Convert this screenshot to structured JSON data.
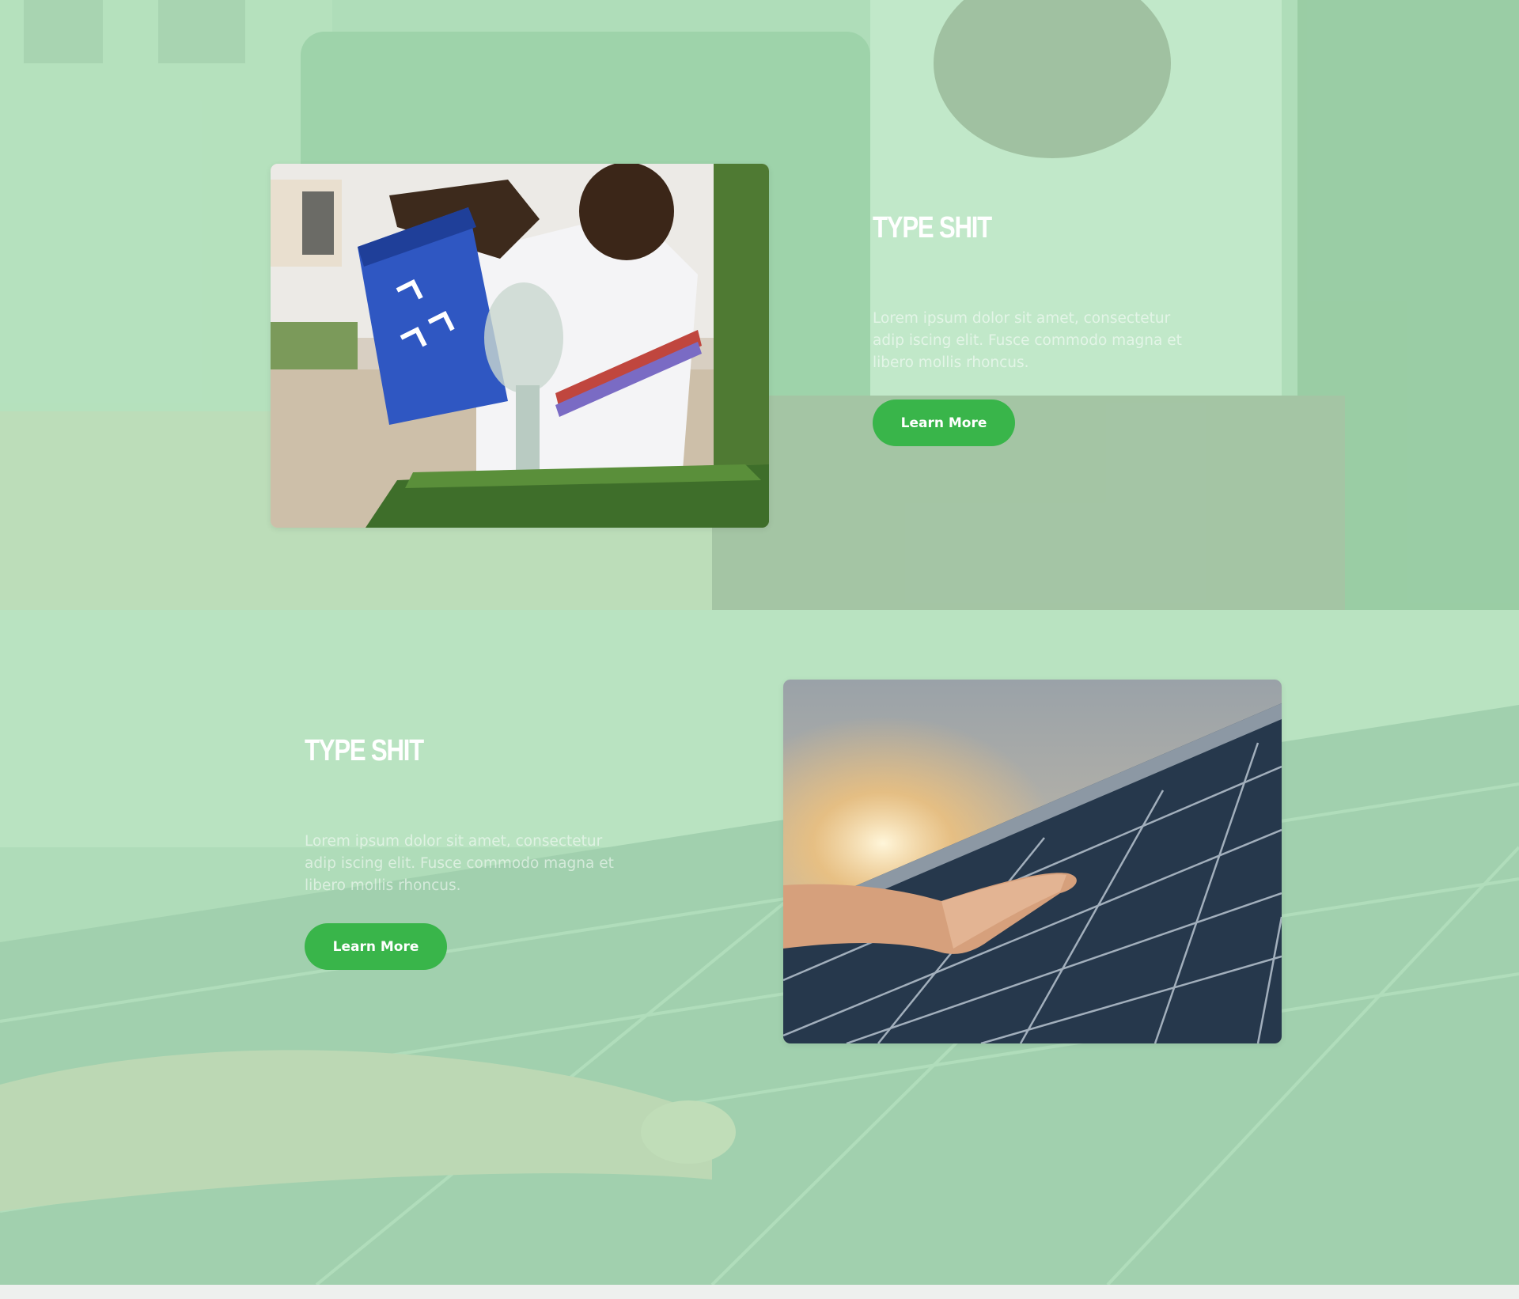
{
  "features": [
    {
      "heading": "TYPE SHIT",
      "body": "Lorem ipsum dolor sit amet, consectetur adip iscing elit. Fusce commodo magna et libero mollis rhoncus.",
      "button_label": "Learn More",
      "image": "recycling-photo"
    },
    {
      "heading": "TYPE SHIT",
      "body": "Lorem ipsum dolor sit amet, consectetur adip iscing elit. Fusce commodo magna et libero mollis rhoncus.",
      "button_label": "Learn More",
      "image": "solar-panel-photo"
    }
  ],
  "colors": {
    "overlay": "#b8e8c2",
    "button": "#39b54a",
    "heading": "#ffffff"
  }
}
